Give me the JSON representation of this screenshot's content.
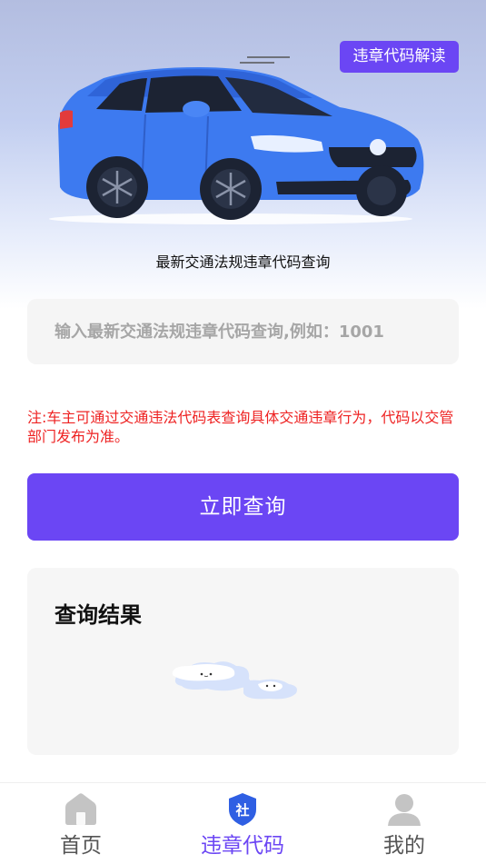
{
  "hero": {
    "badge_label": "违章代码解读",
    "subtitle": "最新交通法规违章代码查询"
  },
  "search": {
    "placeholder": "输入最新交通法规违章代码查询,例如：1001",
    "value": ""
  },
  "note": "注:车主可通过交通违法代码表查询具体交通违章行为，代码以交管部门发布为准。",
  "query_button_label": "立即查询",
  "result": {
    "title": "查询结果"
  },
  "tabbar": {
    "items": [
      {
        "label": "首页",
        "icon": "home-icon",
        "active": false
      },
      {
        "label": "违章代码",
        "icon": "shield-icon",
        "active": true
      },
      {
        "label": "我的",
        "icon": "user-icon",
        "active": false
      }
    ],
    "shield_char": "社"
  },
  "colors": {
    "accent": "#6b46f4",
    "note_red": "#ee2222",
    "car_blue": "#3d7af0"
  }
}
